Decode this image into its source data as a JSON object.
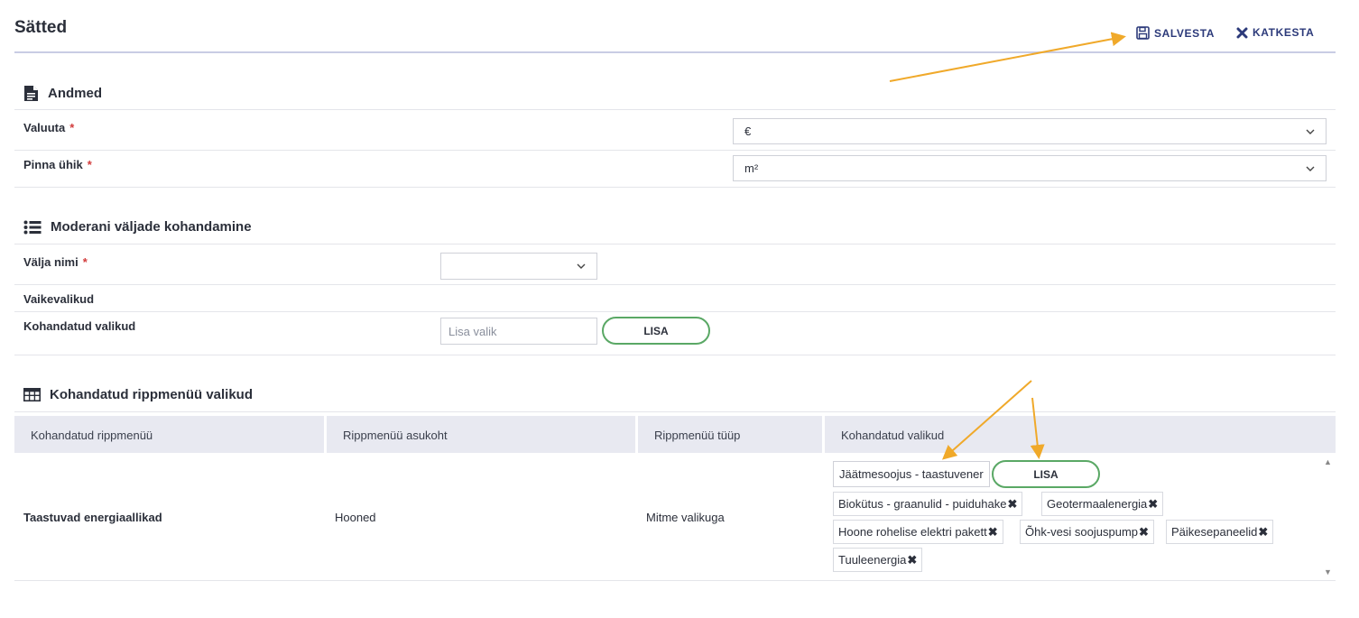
{
  "page": {
    "title": "Sätted"
  },
  "toolbar": {
    "save_label": "SALVESTA",
    "cancel_label": "KATKESTA"
  },
  "andmed": {
    "title": "Andmed",
    "currency_label": "Valuuta",
    "currency_value": "€",
    "area_label": "Pinna ühik",
    "area_value": "m²",
    "required_mark": "*"
  },
  "moderan": {
    "title": "Moderani väljade kohandamine",
    "field_name_label": "Välja nimi",
    "field_name_value": "",
    "default_options_label": "Vaikevalikud",
    "custom_options_label": "Kohandatud valikud",
    "add_placeholder": "Lisa valik",
    "add_button": "LISA"
  },
  "dropdowns": {
    "title": "Kohandatud rippmenüü valikud",
    "columns": [
      "Kohandatud rippmenüü",
      "Rippmenüü asukoht",
      "Rippmenüü tüüp",
      "Kohandatud valikud"
    ],
    "row": {
      "name": "Taastuvad energiaallikad",
      "location": "Hooned",
      "type": "Mitme valikuga",
      "input_value": "Jäätmesoojus - taastuvenergia",
      "add_button": "LISA",
      "tags": [
        "Biokütus - graanulid - puiduhake",
        "Geotermaalenergia",
        "Hoone rohelise elektri pakett",
        "Õhk-vesi soojuspump",
        "Päikesepaneelid",
        "Tuuleenergia"
      ]
    }
  },
  "icons": {
    "save": "floppy-disk-icon",
    "cancel": "close-icon",
    "andmed": "file-text-icon",
    "moderan": "list-icon",
    "dropdowns": "table-icon",
    "select": "chevron-down-icon",
    "remove": "remove-x-icon"
  },
  "colors": {
    "accent": "#2c3a7a",
    "add_border": "#5aa865",
    "required": "#d23c3c",
    "annotation": "#f0a92a"
  }
}
